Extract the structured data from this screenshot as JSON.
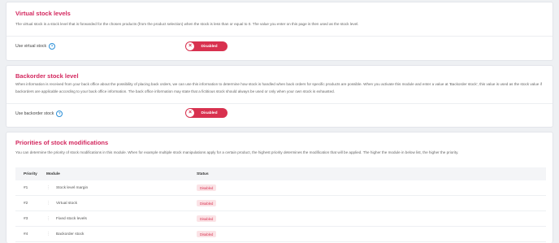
{
  "virtual_stock": {
    "title": "Virtual stock levels",
    "description": "The virtual stock is a stock level that is forwarded for the chosen products (from the product selection) when the stock is less than or equal to 0. The value you enter on this page is then used as the stock level.",
    "field_label": "Use virtual stock",
    "help_icon": "?",
    "toggle_label": "Disabled",
    "toggle_icon": "×"
  },
  "backorder_stock": {
    "title": "Backorder stock level",
    "description": "When information is received from your back office about the possibility of placing back orders, we can use this information to determine how stock is handled when back orders for specific products are possible. When you activate this module and enter a value at 'Backorder stock', this value is used as the stock value if backorders are applicable according to your back office information. The back office information may state that a fictitious stock should always be used or only when your own stock is exhausted.",
    "field_label": "Use backorder stock",
    "help_icon": "?",
    "toggle_label": "Disabled",
    "toggle_icon": "×"
  },
  "priorities": {
    "title": "Priorities of stock modifications",
    "description": "You can determine the priority of stock modifications in this module. When for example multiple stock manipulations apply for a certain product, the highest priority determines the modification that will be applied. The higher the module in below list, the higher the priority.",
    "columns": {
      "priority": "Priority",
      "module": "Module",
      "status": "Status"
    },
    "rows": [
      {
        "priority": "#1",
        "module": "Stock level margin",
        "status": "Disabled"
      },
      {
        "priority": "#2",
        "module": "Virtual stock",
        "status": "Disabled"
      },
      {
        "priority": "#3",
        "module": "Fixed stock levels",
        "status": "Disabled"
      },
      {
        "priority": "#4",
        "module": "Backorder stock",
        "status": "Disabled"
      }
    ],
    "drag_icon": "⋮"
  },
  "colors": {
    "accent": "#d3275e",
    "toggle_off": "#d8314f",
    "help": "#2b8fd8",
    "badge_bg": "#fbe3e6"
  }
}
